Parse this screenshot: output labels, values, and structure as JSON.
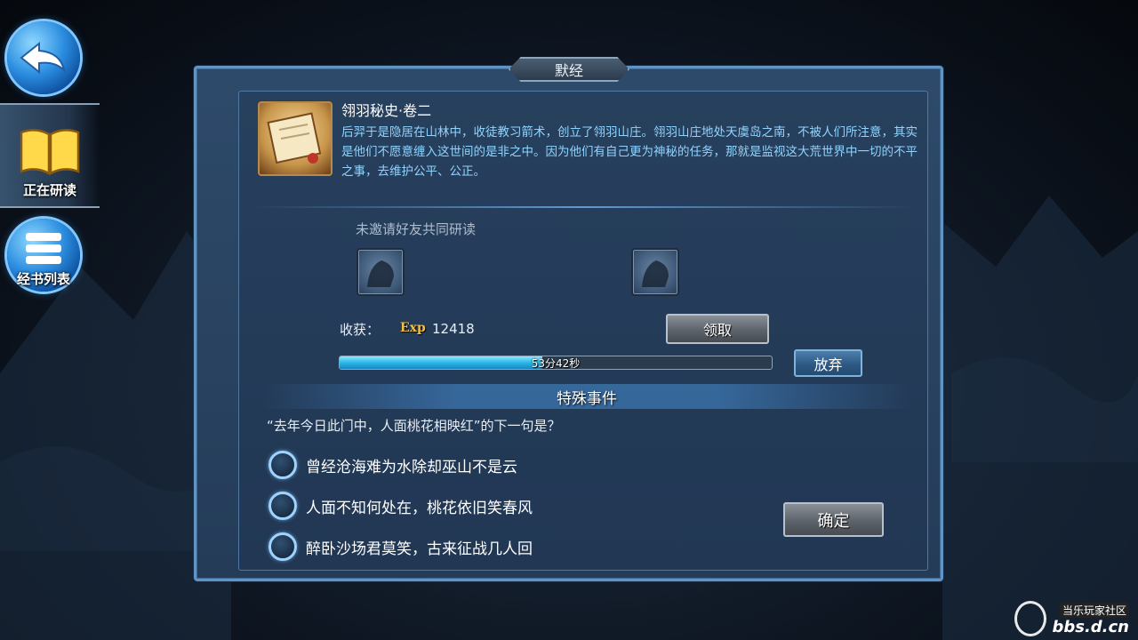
{
  "sidebar": {
    "back_icon": "back-arrow-icon",
    "active_tab_label": "正在研读",
    "list_tab_label": "经书列表"
  },
  "panel": {
    "title": "默经"
  },
  "book": {
    "icon": "scroll-icon",
    "title": "翎羽秘史·卷二",
    "description": "后羿于是隐居在山林中，收徒教习箭术，创立了翎羽山庄。翎羽山庄地处天虞岛之南，不被人们所注意，其实是他们不愿意缠入这世间的是非之中。因为他们有自己更为神秘的任务，那就是监视这大荒世界中一切的不平之事，去维护公平、公正。"
  },
  "invite": {
    "text": "未邀请好友共同研读"
  },
  "reward": {
    "label": "收获：",
    "exp_tag": "Exp",
    "exp_value": "12418",
    "claim_button": "领取",
    "abandon_button": "放弃"
  },
  "progress": {
    "time_text": "53分42秒",
    "fraction": 0.47
  },
  "event": {
    "title": "特殊事件",
    "question": "“去年今日此门中，人面桃花相映红”的下一句是？",
    "options": [
      "曾经沧海难为水除却巫山不是云",
      "人面不知何处在，桃花依旧笑春风",
      "醉卧沙场君莫笑，古来征战几人回"
    ],
    "confirm_button": "确定"
  },
  "watermark": {
    "top": "当乐玩家社区",
    "bottom": "bbs.d.cn"
  }
}
